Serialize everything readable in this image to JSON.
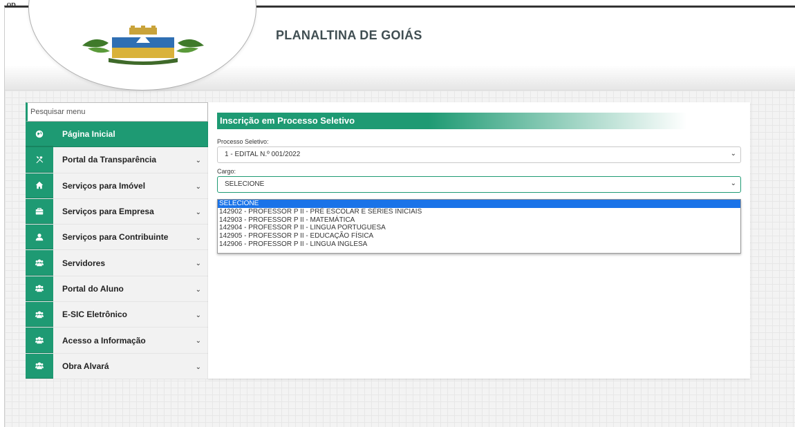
{
  "top_corner_text": "_ op",
  "header": {
    "site_title": "PLANALTINA DE GOIÁS"
  },
  "sidebar": {
    "search_placeholder": "Pesquisar menu",
    "items": [
      {
        "label": "Página Inicial",
        "icon": "globe-icon",
        "active": true
      },
      {
        "label": "Portal da Transparência",
        "icon": "tools-icon"
      },
      {
        "label": "Serviços para Imóvel",
        "icon": "home-icon"
      },
      {
        "label": "Serviços para Empresa",
        "icon": "briefcase-icon"
      },
      {
        "label": "Serviços para Contribuinte",
        "icon": "user-icon"
      },
      {
        "label": "Servidores",
        "icon": "users-icon"
      },
      {
        "label": "Portal do Aluno",
        "icon": "users-icon"
      },
      {
        "label": "E-SIC Eletrônico",
        "icon": "users-icon"
      },
      {
        "label": "Acesso a Informação",
        "icon": "users-icon"
      },
      {
        "label": "Obra Alvará",
        "icon": "users-icon"
      }
    ]
  },
  "main": {
    "heading": "Inscrição em Processo Seletivo",
    "processo_label": "Processo Seletivo:",
    "processo_value": "1 - EDITAL N.º 001/2022",
    "cargo_label": "Cargo:",
    "cargo_value": "SELECIONE",
    "cargo_options": [
      "SELECIONE",
      "142902 - PROFESSOR P II - PRÉ ESCOLAR E SÉRIES INICIAIS",
      "142903 - PROFESSOR P II - MATEMÁTICA",
      "142904 - PROFESSOR P II - LINGUA PORTUGUESA",
      "142905 - PROFESSOR P II - EDUCAÇÃO FÍSICA",
      "142906 - PROFESSOR P II - LINGUA INGLESA"
    ],
    "selected_option_index": 0
  },
  "colors": {
    "brand_green": "#1e9a73",
    "dropdown_highlight": "#1a73e8",
    "title_text": "#404e52"
  }
}
